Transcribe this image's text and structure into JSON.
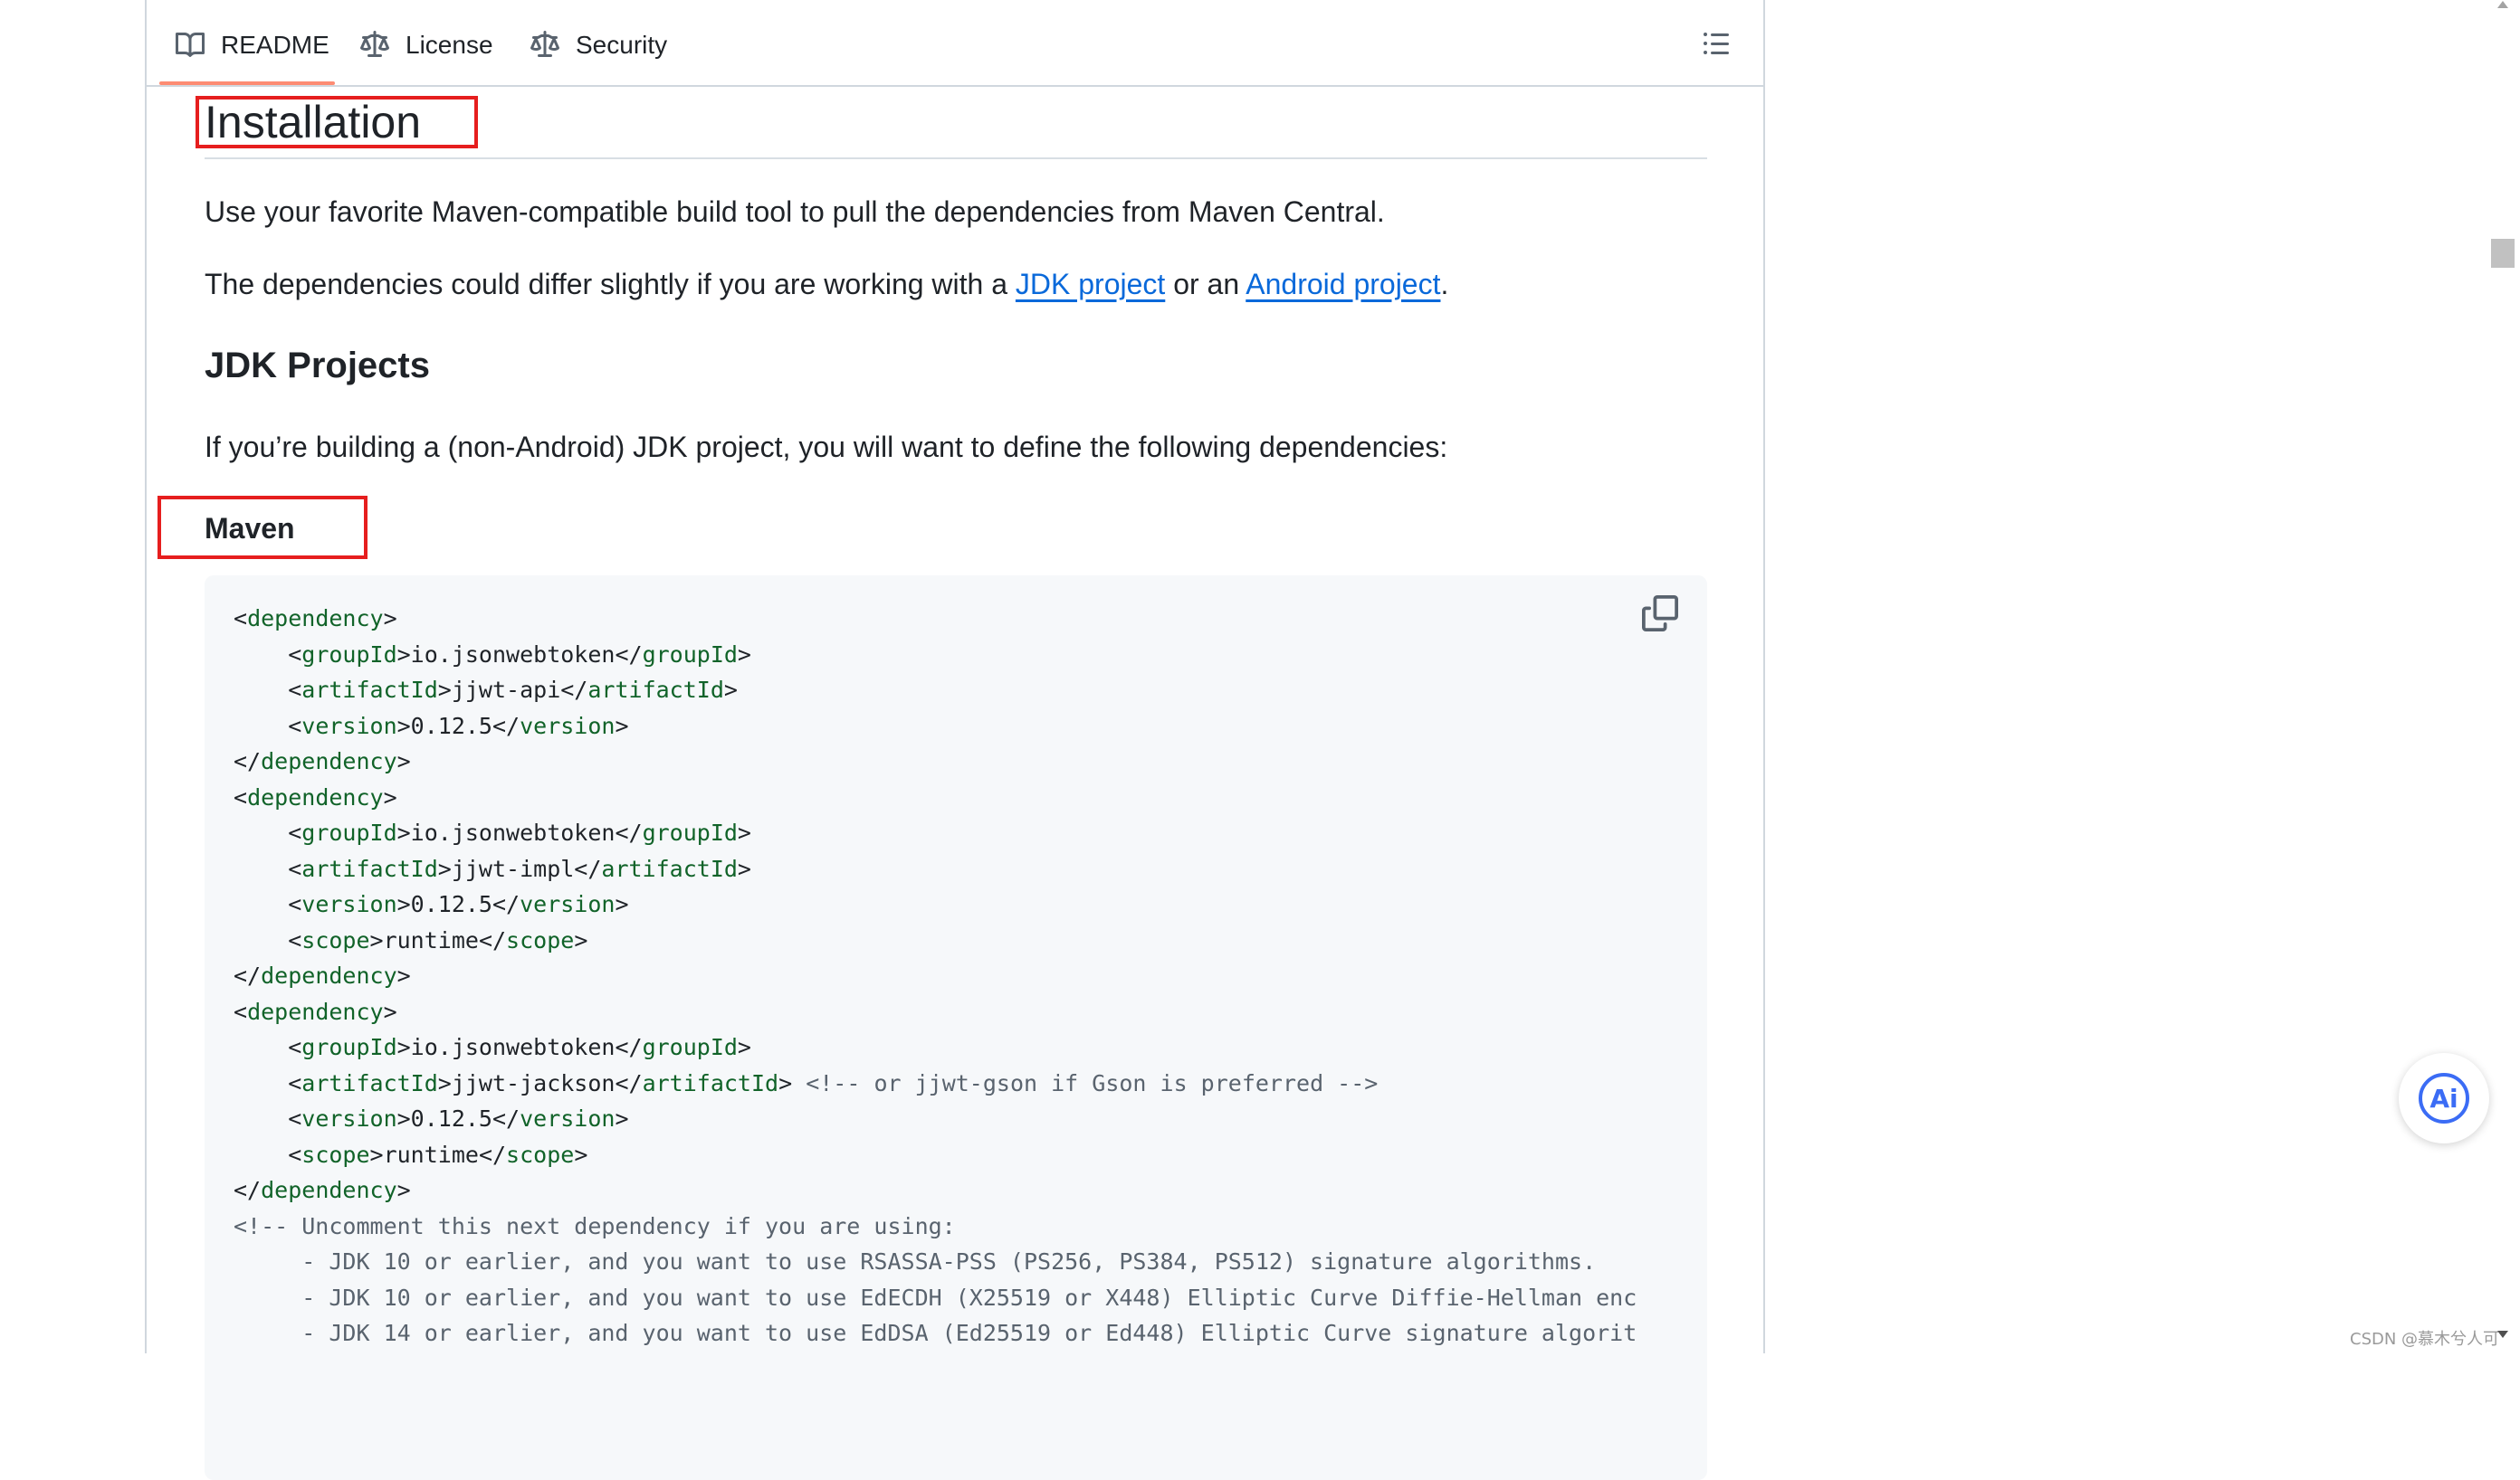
{
  "tabs": [
    {
      "label": "README",
      "icon": "book-icon",
      "active": true
    },
    {
      "label": "License",
      "icon": "law-icon"
    },
    {
      "label": "Security",
      "icon": "law-icon"
    }
  ],
  "headings": {
    "installation": "Installation",
    "jdk_projects": "JDK Projects",
    "maven": "Maven"
  },
  "paragraphs": {
    "intro": "Use your favorite Maven-compatible build tool to pull the dependencies from Maven Central.",
    "differ_prefix": "The dependencies could differ slightly if you are working with a ",
    "jdk_link": "JDK project",
    "differ_mid": " or an ",
    "android_link": "Android project",
    "differ_suffix": ".",
    "jdk_desc": "If you’re building a (non-Android) JDK project, you will want to define the following dependencies:"
  },
  "code": {
    "lines": [
      "<dependency>",
      "    <groupId>io.jsonwebtoken</groupId>",
      "    <artifactId>jjwt-api</artifactId>",
      "    <version>0.12.5</version>",
      "</dependency>",
      "<dependency>",
      "    <groupId>io.jsonwebtoken</groupId>",
      "    <artifactId>jjwt-impl</artifactId>",
      "    <version>0.12.5</version>",
      "    <scope>runtime</scope>",
      "</dependency>",
      "<dependency>",
      "    <groupId>io.jsonwebtoken</groupId>",
      "    <artifactId>jjwt-jackson</artifactId> <!-- or jjwt-gson if Gson is preferred -->",
      "    <version>0.12.5</version>",
      "    <scope>runtime</scope>",
      "</dependency>",
      "<!-- Uncomment this next dependency if you are using:",
      "     - JDK 10 or earlier, and you want to use RSASSA-PSS (PS256, PS384, PS512) signature algorithms.",
      "     - JDK 10 or earlier, and you want to use EdECDH (X25519 or X448) Elliptic Curve Diffie-Hellman enc",
      "     - JDK 14 or earlier, and you want to use EdDSA (Ed25519 or Ed448) Elliptic Curve signature algorit"
    ]
  },
  "icons": {
    "toc": "list-icon",
    "copy": "copy-icon",
    "ai": "ai-assistant-icon"
  },
  "ai_label": "Ai",
  "watermark": "CSDN @慕木兮人可",
  "colors": {
    "link": "#0969da",
    "tab_underline": "#fd8c73",
    "annotation_box": "#e61e1e",
    "code_bg": "#f6f8fa"
  }
}
